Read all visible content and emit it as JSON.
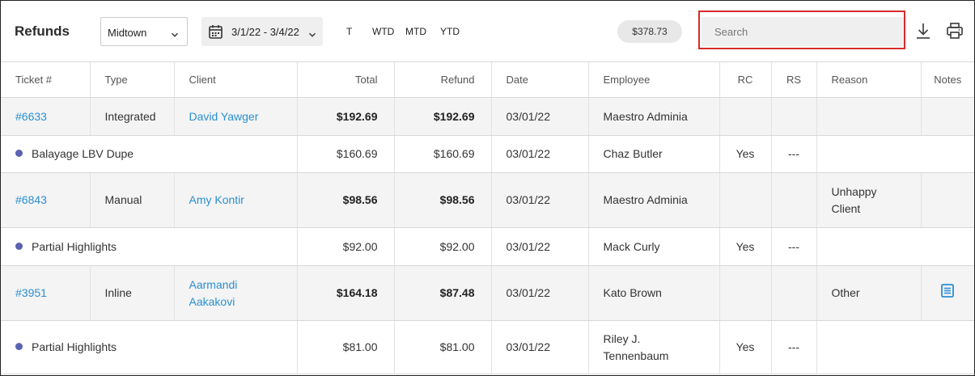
{
  "header": {
    "title": "Refunds",
    "location": "Midtown",
    "date_range": "3/1/22 - 3/4/22",
    "quick_ranges": [
      "T",
      "WTD",
      "MTD",
      "YTD"
    ],
    "total_badge": "$378.73",
    "search_placeholder": "Search",
    "search_value": "",
    "icons": {
      "download": "download-icon",
      "print": "printer-icon",
      "calendar": "calendar-icon"
    }
  },
  "table": {
    "columns": [
      "Ticket #",
      "Type",
      "Client",
      "Total",
      "Refund",
      "Date",
      "Employee",
      "RC",
      "RS",
      "Reason",
      "Notes"
    ],
    "rows": [
      {
        "ticket": "#6633",
        "type": "Integrated",
        "client": "David Yawger",
        "total": "$192.69",
        "refund": "$192.69",
        "date": "03/01/22",
        "employee": "Maestro Adminia",
        "rc": "",
        "rs": "",
        "reason": "",
        "notes": ""
      },
      {
        "item": "Balayage LBV Dupe",
        "total": "$160.69",
        "refund": "$160.69",
        "date": "03/01/22",
        "employee": "Chaz Butler",
        "rc": "Yes",
        "rs": "---"
      },
      {
        "ticket": "#6843",
        "type": "Manual",
        "client": "Amy Kontir",
        "total": "$98.56",
        "refund": "$98.56",
        "date": "03/01/22",
        "employee": "Maestro Adminia",
        "rc": "",
        "rs": "",
        "reason": "Unhappy Client",
        "notes": ""
      },
      {
        "item": "Partial Highlights",
        "total": "$92.00",
        "refund": "$92.00",
        "date": "03/01/22",
        "employee": "Mack Curly",
        "rc": "Yes",
        "rs": "---"
      },
      {
        "ticket": "#3951",
        "type": "Inline",
        "client": "Aarmandi Aakakovi",
        "total": "$164.18",
        "refund": "$87.48",
        "date": "03/01/22",
        "employee": "Kato Brown",
        "rc": "",
        "rs": "",
        "reason": "Other",
        "notes": "note-icon"
      },
      {
        "item": "Partial Highlights",
        "total": "$81.00",
        "refund": "$81.00",
        "date": "03/01/22",
        "employee": "Riley J. Tennenbaum",
        "rc": "Yes",
        "rs": "---"
      }
    ]
  },
  "colors": {
    "link": "#2a8fd0",
    "dot": "#5a63b0",
    "search_border": "#d52b2b",
    "parent_row_bg": "#f4f4f4"
  }
}
